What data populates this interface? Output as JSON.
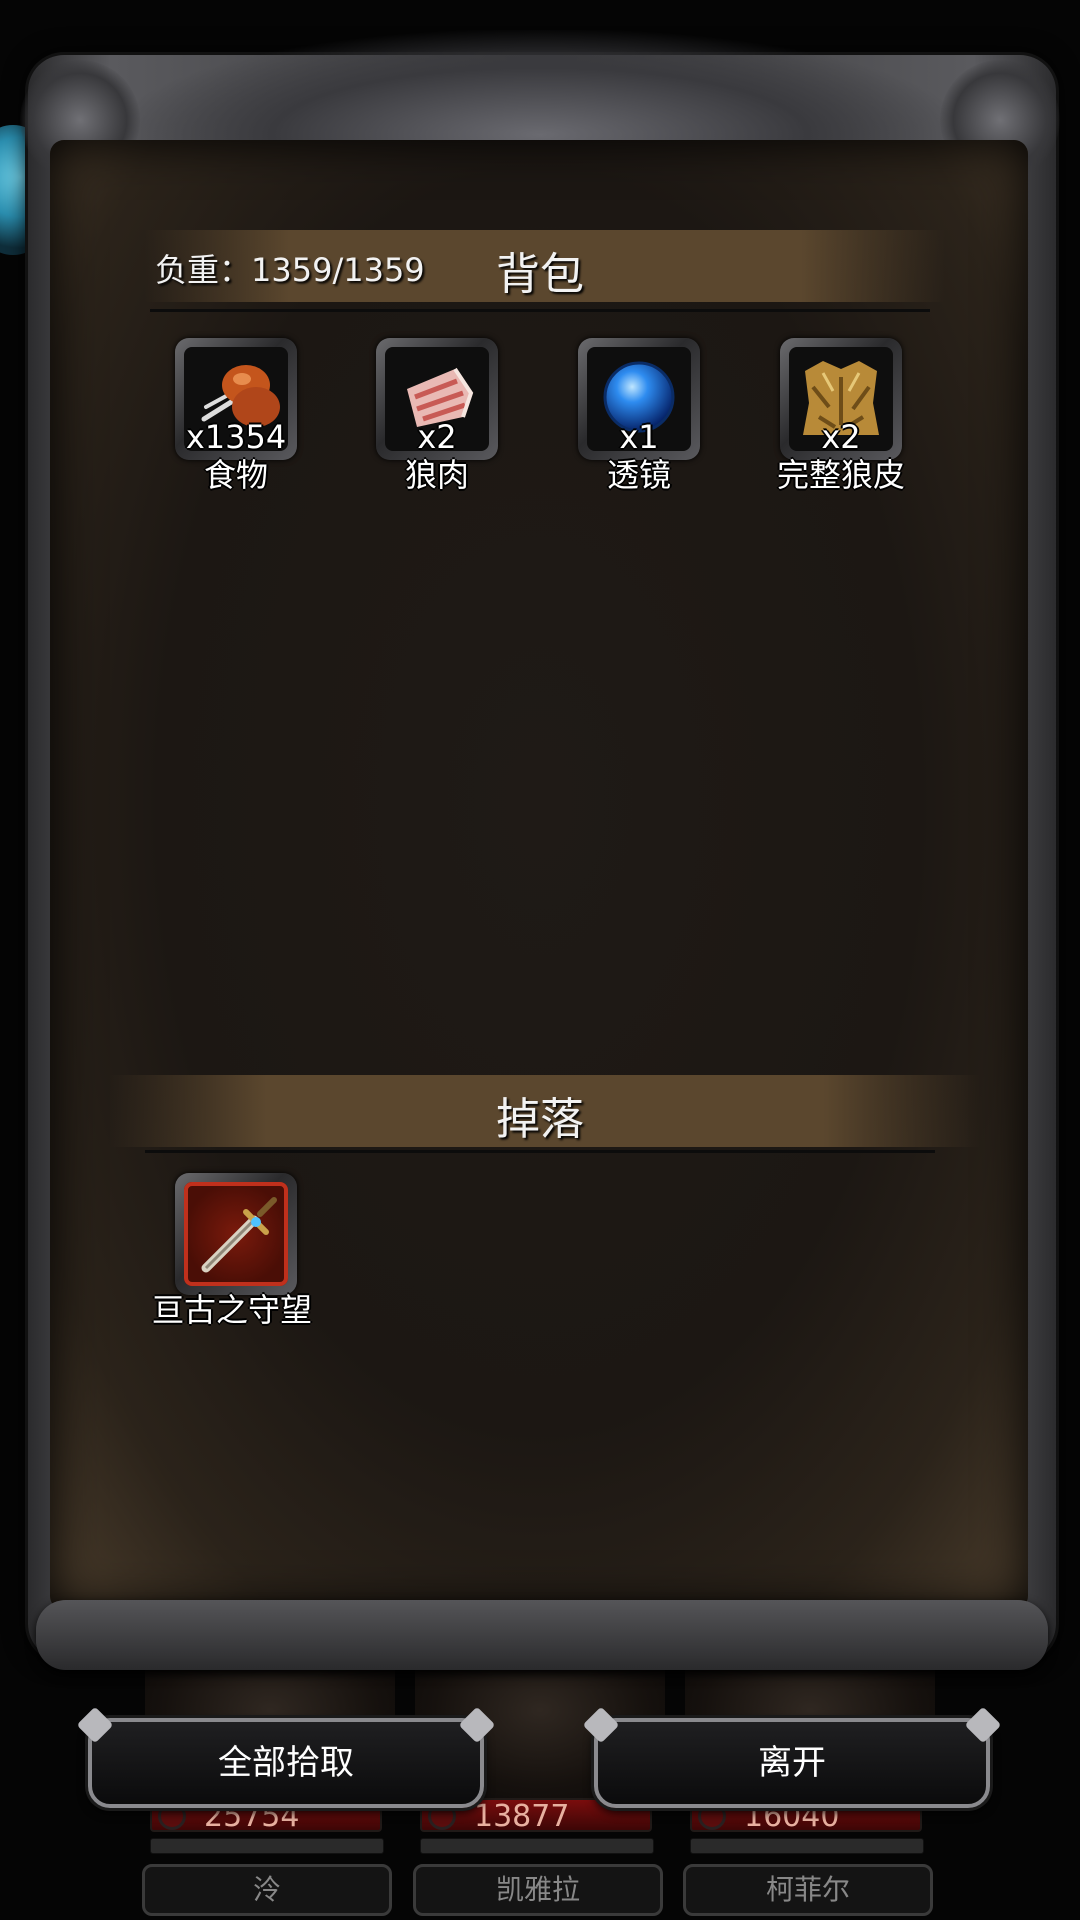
{
  "panel": {
    "weight_label": "负重：1359/1359",
    "backpack_title": "背包",
    "drops_title": "掉落"
  },
  "backpack_items": [
    {
      "name": "食物",
      "qty": "x1354",
      "icon": "roasted-meat-icon"
    },
    {
      "name": "狼肉",
      "qty": "x2",
      "icon": "raw-meat-icon"
    },
    {
      "name": "透镜",
      "qty": "x1",
      "icon": "blue-orb-icon"
    },
    {
      "name": "完整狼皮",
      "qty": "x2",
      "icon": "wolf-pelt-icon"
    }
  ],
  "drop_items": [
    {
      "name": "亘古之守望",
      "icon": "sword-icon",
      "rarity_color": "#c0301c"
    }
  ],
  "buttons": {
    "pickup_all": "全部拾取",
    "leave": "离开"
  },
  "party": [
    {
      "name": "泠",
      "hp": "25754"
    },
    {
      "name": "凯雅拉",
      "hp": "13877"
    },
    {
      "name": "柯菲尔",
      "hp": "16040"
    }
  ]
}
